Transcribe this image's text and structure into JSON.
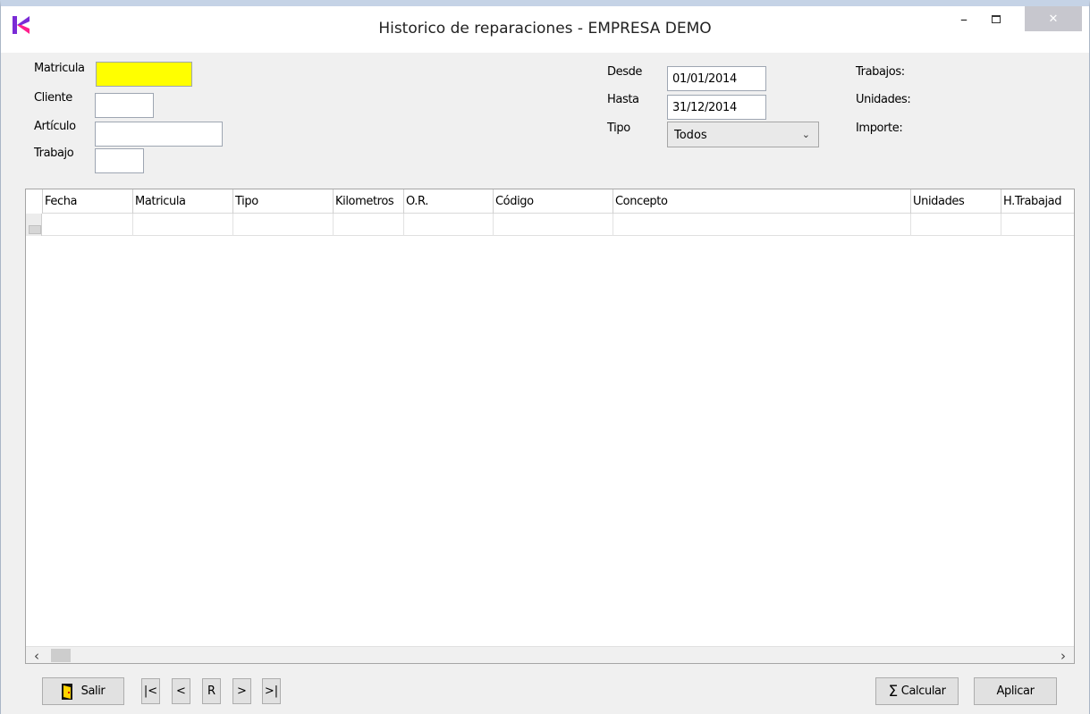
{
  "window": {
    "title": "Historico de reparaciones - EMPRESA DEMO",
    "min_label": "–",
    "close_label": "✕"
  },
  "filters": {
    "matricula": {
      "label": "Matricula",
      "value": ""
    },
    "cliente": {
      "label": "Cliente",
      "value": ""
    },
    "articulo": {
      "label": "Artículo",
      "value": ""
    },
    "trabajo": {
      "label": "Trabajo",
      "value": ""
    },
    "desde": {
      "label": "Desde",
      "value": "01/01/2014"
    },
    "hasta": {
      "label": "Hasta",
      "value": "31/12/2014"
    },
    "tipo": {
      "label": "Tipo",
      "value": "Todos"
    }
  },
  "summary": {
    "trabajos": "Trabajos:",
    "unidades": "Unidades:",
    "importe": "Importe:"
  },
  "grid": {
    "columns": [
      "Fecha",
      "Matricula",
      "Tipo",
      "Kilometros",
      "O.R.",
      "Código",
      "Concepto",
      "Unidades",
      "H.Trabajad"
    ],
    "rows": []
  },
  "buttons": {
    "salir": "Salir",
    "first": "|<",
    "prev": "<",
    "refresh": "R",
    "next": ">",
    "last": ">|",
    "calcular": "Calcular",
    "aplicar": "Aplicar"
  },
  "colors": {
    "highlight_field": "#ffff00",
    "logo_purple": "#8a2be2",
    "logo_pink": "#ff1493"
  }
}
